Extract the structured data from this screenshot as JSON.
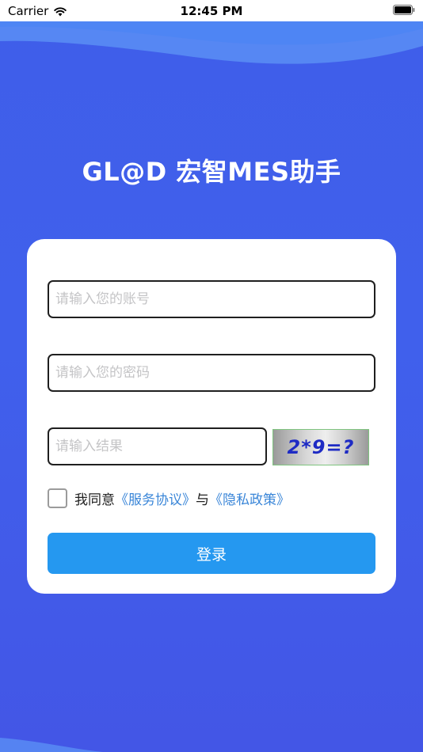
{
  "status_bar": {
    "carrier": "Carrier",
    "time": "12:45 PM",
    "icons": [
      "wifi-icon",
      "battery-icon"
    ]
  },
  "app": {
    "title": "GL@D 宏智MES助手"
  },
  "form": {
    "account_placeholder": "请输入您的账号",
    "password_placeholder": "请输入您的密码",
    "captcha_placeholder": "请输入结果",
    "captcha_text": "2*9=?",
    "agree_text": "我同意",
    "service_link": "《服务协议》",
    "and_text": "与",
    "privacy_link": "《隐私政策》",
    "login_label": "登录"
  },
  "colors": {
    "background": "#4060ec",
    "primary_button": "#2598f0",
    "link": "#3a86d8",
    "captcha_text": "#1e2bc4"
  }
}
